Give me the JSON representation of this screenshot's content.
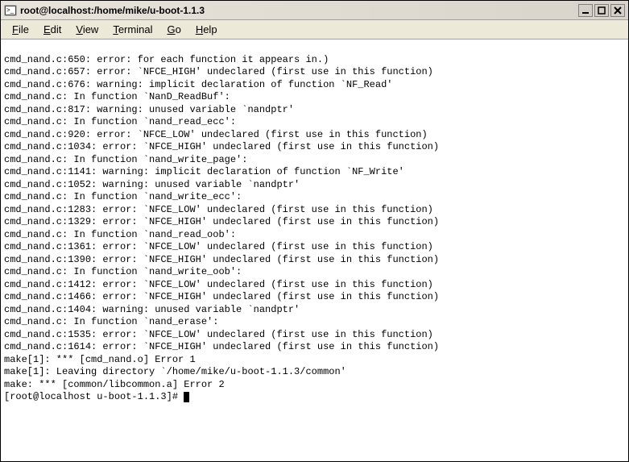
{
  "window": {
    "title": "root@localhost:/home/mike/u-boot-1.1.3"
  },
  "menu": {
    "file": "File",
    "edit": "Edit",
    "view": "View",
    "terminal": "Terminal",
    "go": "Go",
    "help": "Help"
  },
  "lines": [
    "cmd_nand.c:650: error: for each function it appears in.)",
    "cmd_nand.c:657: error: `NFCE_HIGH' undeclared (first use in this function)",
    "cmd_nand.c:676: warning: implicit declaration of function `NF_Read'",
    "cmd_nand.c: In function `NanD_ReadBuf':",
    "cmd_nand.c:817: warning: unused variable `nandptr'",
    "cmd_nand.c: In function `nand_read_ecc':",
    "cmd_nand.c:920: error: `NFCE_LOW' undeclared (first use in this function)",
    "cmd_nand.c:1034: error: `NFCE_HIGH' undeclared (first use in this function)",
    "cmd_nand.c: In function `nand_write_page':",
    "cmd_nand.c:1141: warning: implicit declaration of function `NF_Write'",
    "cmd_nand.c:1052: warning: unused variable `nandptr'",
    "cmd_nand.c: In function `nand_write_ecc':",
    "cmd_nand.c:1283: error: `NFCE_LOW' undeclared (first use in this function)",
    "cmd_nand.c:1329: error: `NFCE_HIGH' undeclared (first use in this function)",
    "cmd_nand.c: In function `nand_read_oob':",
    "cmd_nand.c:1361: error: `NFCE_LOW' undeclared (first use in this function)",
    "cmd_nand.c:1390: error: `NFCE_HIGH' undeclared (first use in this function)",
    "cmd_nand.c: In function `nand_write_oob':",
    "cmd_nand.c:1412: error: `NFCE_LOW' undeclared (first use in this function)",
    "cmd_nand.c:1466: error: `NFCE_HIGH' undeclared (first use in this function)",
    "cmd_nand.c:1404: warning: unused variable `nandptr'",
    "cmd_nand.c: In function `nand_erase':",
    "cmd_nand.c:1535: error: `NFCE_LOW' undeclared (first use in this function)",
    "cmd_nand.c:1614: error: `NFCE_HIGH' undeclared (first use in this function)",
    "make[1]: *** [cmd_nand.o] Error 1",
    "make[1]: Leaving directory `/home/mike/u-boot-1.1.3/common'",
    "make: *** [common/libcommon.a] Error 2"
  ],
  "prompt": "[root@localhost u-boot-1.1.3]# "
}
